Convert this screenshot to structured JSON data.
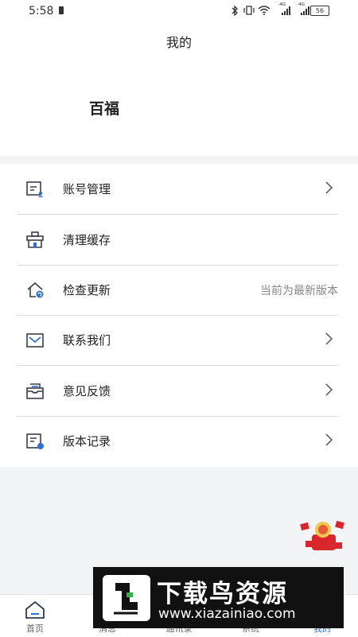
{
  "status_bar": {
    "time": "5:58",
    "signal_left": "⁴ᴳ",
    "signal_right": "⁴ᴳ",
    "battery": "56"
  },
  "header": {
    "title": "我的",
    "username": "百福"
  },
  "menu": [
    {
      "label": "账号管理",
      "icon": "account-manage-icon",
      "right": ""
    },
    {
      "label": "清理缓存",
      "icon": "clean-cache-icon",
      "right": ""
    },
    {
      "label": "检查更新",
      "icon": "check-update-icon",
      "right": "当前为最新版本"
    },
    {
      "label": "联系我们",
      "icon": "mail-icon",
      "right": ""
    },
    {
      "label": "意见反馈",
      "icon": "feedback-icon",
      "right": ""
    },
    {
      "label": "版本记录",
      "icon": "version-record-icon",
      "right": ""
    }
  ],
  "banner": {
    "title": "下载鸟资源",
    "url": "www.xiazainiao.com"
  },
  "tabs": [
    {
      "label": "首页",
      "icon": "home-icon"
    },
    {
      "label": "消息",
      "icon": "message-icon"
    },
    {
      "label": "通讯录",
      "icon": "contacts-icon"
    },
    {
      "label": "系统",
      "icon": "system-icon"
    },
    {
      "label": "我的",
      "icon": "me-icon"
    }
  ],
  "colors": {
    "accent": "#2f6fd6",
    "icon_gray": "#3a3f4b",
    "divider": "#dcdcdc"
  }
}
